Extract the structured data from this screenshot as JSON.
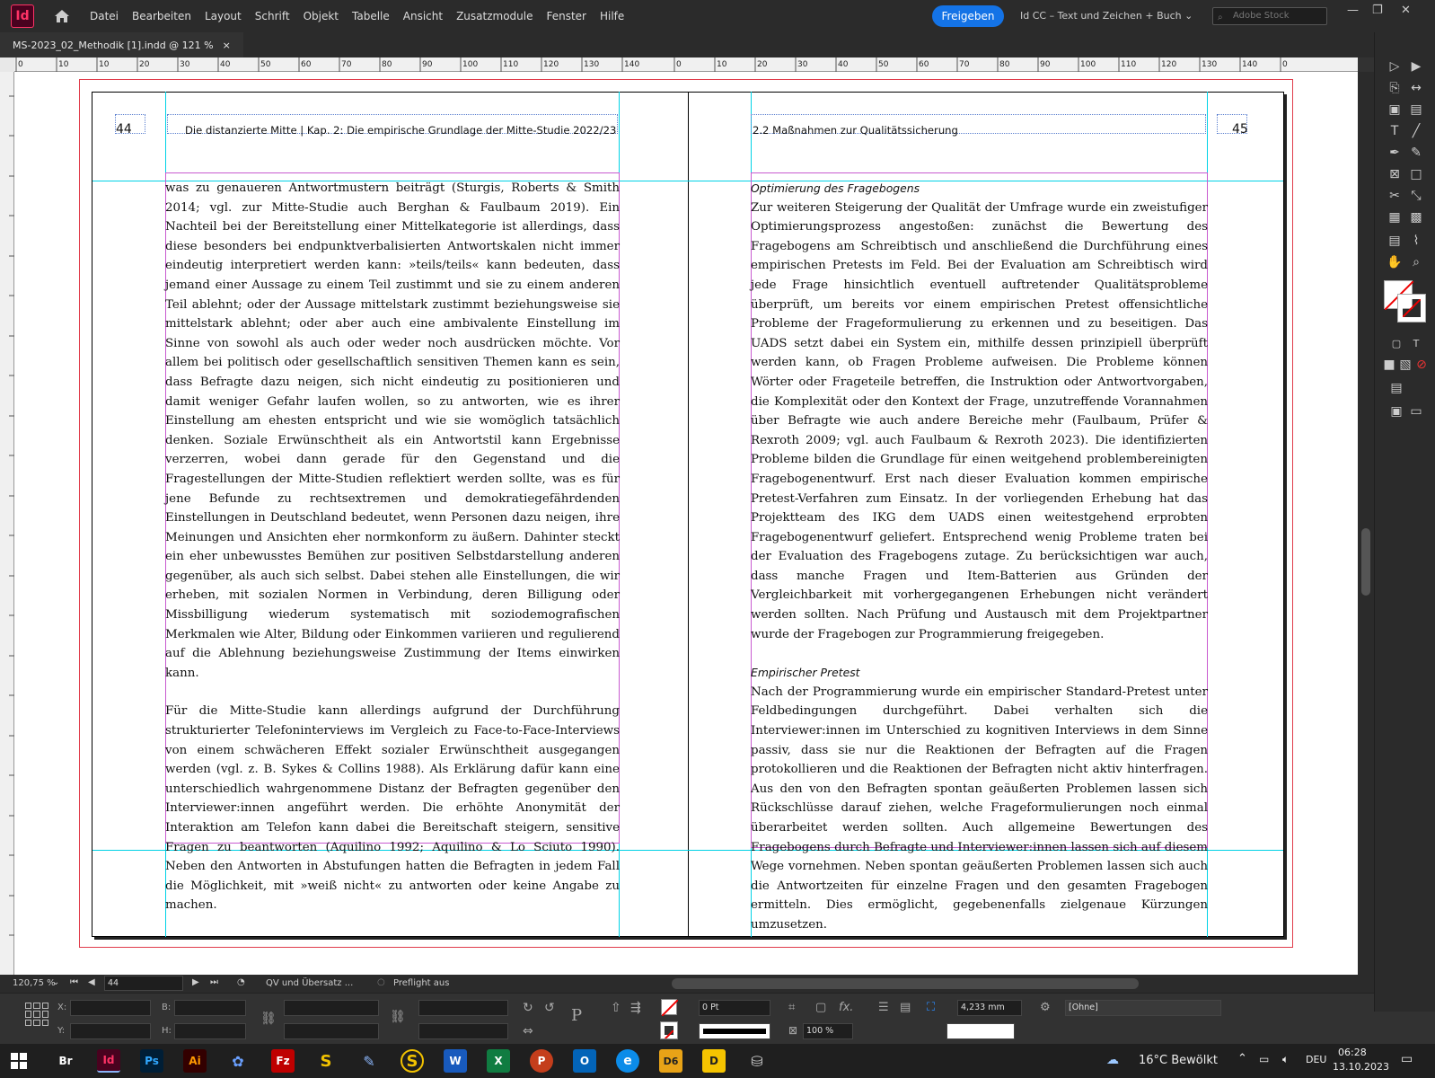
{
  "app": {
    "logo": "Id",
    "share_label": "Freigeben",
    "workspace": "Id CC – Text und Zeichen + Buch",
    "stock_placeholder": "Adobe Stock"
  },
  "menu": [
    "Datei",
    "Bearbeiten",
    "Layout",
    "Schrift",
    "Objekt",
    "Tabelle",
    "Ansicht",
    "Zusatzmodule",
    "Fenster",
    "Hilfe"
  ],
  "document_tab": {
    "title": "MS-2023_02_Methodik [1].indd @ 121 %",
    "close": "×"
  },
  "ruler": {
    "left_ticks": [
      "0",
      "10",
      "10",
      "20",
      "30",
      "40",
      "50",
      "60",
      "70",
      "80",
      "90",
      "100",
      "110",
      "120",
      "130",
      "140"
    ],
    "right_ticks": [
      "0",
      "10",
      "20",
      "30",
      "40",
      "50",
      "60",
      "70",
      "80",
      "90",
      "100",
      "110",
      "120",
      "130",
      "140",
      "0"
    ]
  },
  "page_left": {
    "number": "44",
    "header": "Die distanzierte Mitte | Kap. 2: Die empirische Grundlage der Mitte-Studie 2022/23",
    "paragraphs": [
      "was zu genaueren Antwortmustern beiträgt (Sturgis, Roberts & Smith 2014; vgl. zur Mitte-Studie auch Berghan & Faulbaum 2019). Ein Nachteil bei der Bereitstellung einer Mittelkategorie ist allerdings, dass diese besonders bei endpunktverbalisierten Antwortskalen nicht immer eindeutig interpretiert werden kann: »teils/teils« kann bedeuten, dass jemand einer Aussage zu einem Teil zustimmt und sie zu einem anderen Teil ablehnt; oder der Aussage mittelstark zustimmt beziehungsweise sie mittelstark ablehnt; oder aber auch eine ambivalente Einstellung im Sinne von sowohl als auch oder weder noch ausdrücken möchte. Vor allem bei politisch oder gesellschaftlich sensitiven Themen kann es sein, dass Befragte dazu neigen, sich nicht eindeutig zu positionieren und damit weniger Gefahr laufen wollen, so zu antworten, wie es ihrer Einstellung am ehesten entspricht und wie sie womöglich tatsächlich denken. Soziale Erwünschtheit als ein Antwortstil kann Ergebnisse verzerren, wobei dann gerade für den Gegenstand und die Fragestellungen der Mitte-Studien reflektiert werden sollte, was es für jene Befunde zu rechtsextremen und demokratiegefährdenden Einstellungen in Deutschland bedeutet, wenn Personen dazu neigen, ihre Meinungen und Ansichten eher normkonform zu äußern. Dahinter steckt ein eher unbewusstes Bemühen zur positiven Selbstdarstellung anderen gegenüber, als auch sich selbst. Dabei stehen alle Einstellungen, die wir erheben, mit sozialen Normen in Verbindung, deren Billigung oder Missbilligung wiederum systematisch mit soziodemografischen Merkmalen wie Alter, Bildung oder Einkommen variieren und regulierend auf die Ablehnung beziehungsweise Zustimmung der Items einwirken kann.",
      "Für die Mitte-Studie kann allerdings aufgrund der Durchführung strukturierter Telefoninterviews im Vergleich zu Face-to-Face-Interviews von einem schwächeren Effekt sozialer Erwünschtheit ausgegangen werden (vgl. z. B. Sykes & Collins 1988). Als Erklärung dafür kann eine unterschiedlich wahrgenommene Distanz der Befragten gegenüber den Interviewer:innen angeführt werden. Die erhöhte Anonymität der Interaktion am Telefon kann dabei die Bereitschaft steigern, sensitive Fragen zu beantworten (Aquilino 1992; Aquilino & Lo Sciuto 1990). Neben den Antworten in Abstufungen hatten die Befragten in jedem Fall die Möglichkeit, mit »weiß nicht« zu antworten oder keine Angabe zu machen."
    ]
  },
  "page_right": {
    "number": "45",
    "header": "2.2 Maßnahmen zur Qualitätssicherung",
    "heading1": "Optimierung des Fragebogens",
    "para1": "Zur weiteren Steigerung der Qualität der Umfrage wurde ein zweistufiger Optimierungsprozess angestoßen: zunächst die Bewertung des Fragebogens am Schreibtisch und anschließend die Durchführung eines empirischen Pretests im Feld. Bei der Evaluation am Schreibtisch wird jede Frage hinsichtlich eventuell auftretender Qualitätsprobleme überprüft, um bereits vor einem empirischen Pretest offensichtliche Probleme der Frageformulierung zu erkennen und zu beseitigen. Das UADS setzt dabei ein System ein, mithilfe dessen prinzipiell überprüft werden kann, ob Fragen Probleme aufweisen. Die Probleme können Wörter oder Frageteile betreffen, die Instruktion oder Antwortvorgaben, die Komplexität oder den Kontext der Frage, unzutreffende Vorannahmen über Befragte wie auch andere Bereiche mehr (Faulbaum, Prüfer & Rexroth 2009; vgl. auch Faulbaum & Rexroth 2023). Die identifizierten Probleme bilden die Grundlage für einen weitgehend problembereinigten Fragebogenentwurf. Erst nach dieser Evaluation kommen empirische Pretest-Verfahren zum Einsatz. In der vorliegenden Erhebung hat das Projektteam des IKG dem UADS einen weitestgehend erprobten Fragebogenentwurf geliefert. Entsprechend wenig Probleme traten bei der Evaluation des Fragebogens zutage. Zu berücksichtigen war auch, dass manche Fragen und Item-Batterien aus Gründen der Vergleichbarkeit mit vorhergegangenen Erhebungen nicht verändert werden sollten. Nach Prüfung und Austausch mit dem Projektpartner wurde der Fragebogen zur Programmierung freigegeben.",
    "heading2": "Empirischer Pretest",
    "para2": "Nach der Programmierung wurde ein empirischer Standard-Pretest unter Feldbedingungen durchgeführt. Dabei verhalten sich die Interviewer:innen im Unterschied zu kognitiven Interviews in dem Sinne passiv, dass sie nur die Reaktionen der Befragten auf die Fragen protokollieren und die Reaktionen der Befragten nicht aktiv hinterfragen. Aus den von den Befragten spontan geäußerten Problemen lassen sich Rückschlüsse darauf ziehen, welche Frageformulierungen noch einmal überarbeitet werden sollten. Auch allgemeine Bewertungen des Fragebogens durch Befragte und Interviewer:innen lassen sich auf diesem Wege vornehmen. Neben spontan geäußerten Problemen lassen sich auch die Antwortzeiten für einzelne Fragen und den gesamten Fragebogen ermitteln. Dies ermöglicht, gegebenenfalls zielgenaue Kürzungen umzusetzen."
  },
  "status": {
    "zoom": "120,75 %",
    "page": "44",
    "preflight_profile": "QV und Übersatz ...",
    "preflight_status": "Preflight aus"
  },
  "control": {
    "x_label": "X:",
    "y_label": "Y:",
    "w_label": "B:",
    "h_label": "H:",
    "stroke_weight": "0 Pt",
    "opacity": "100 %",
    "gutter": "4,233 mm",
    "object_style": "[Ohne]"
  },
  "taskbar": {
    "apps": [
      "Br",
      "Id",
      "Ps",
      "Ai",
      "Fz",
      "S",
      "W",
      "X",
      "P",
      "O",
      "D6",
      "D"
    ],
    "weather": "16°C  Bewölkt",
    "lang": "DEU",
    "time": "06:28",
    "date": "13.10.2023"
  },
  "colors": {
    "accent": "#1473e6",
    "indesign": "#ff3366",
    "guide": "#00d2e6",
    "margin": "#c85ad0"
  }
}
